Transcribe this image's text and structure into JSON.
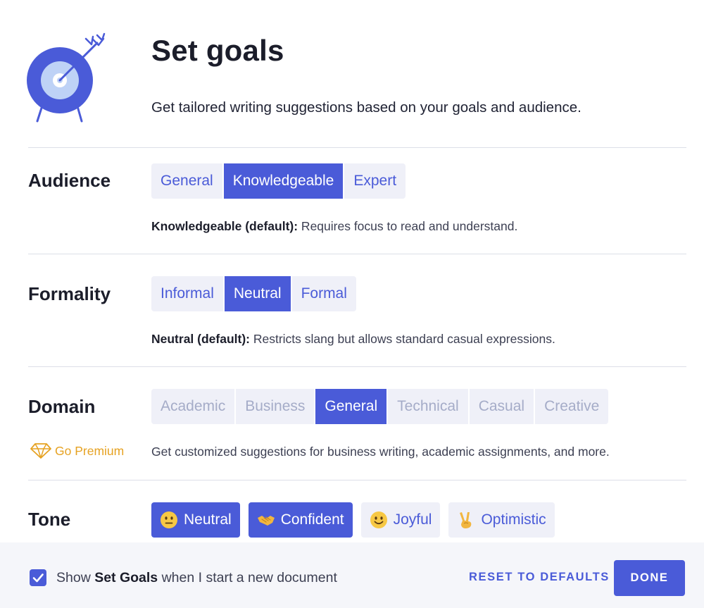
{
  "header": {
    "title": "Set goals",
    "subtitle": "Get tailored writing suggestions based on your goals and audience."
  },
  "audience": {
    "label": "Audience",
    "options": [
      "General",
      "Knowledgeable",
      "Expert"
    ],
    "selected": "Knowledgeable",
    "desc_bold": "Knowledgeable (default):",
    "desc_text": " Requires focus to read and understand."
  },
  "formality": {
    "label": "Formality",
    "options": [
      "Informal",
      "Neutral",
      "Formal"
    ],
    "selected": "Neutral",
    "desc_bold": "Neutral (default):",
    "desc_text": " Restricts slang but allows standard casual expressions."
  },
  "domain": {
    "label": "Domain",
    "options": [
      "Academic",
      "Business",
      "General",
      "Technical",
      "Casual",
      "Creative"
    ],
    "selected": "General",
    "premium_label": "Go Premium",
    "desc_text": "Get customized suggestions for business writing, academic assignments, and more."
  },
  "tone": {
    "label": "Tone",
    "options": [
      {
        "label": "Neutral",
        "icon": "neutral-face-icon",
        "active": true
      },
      {
        "label": "Confident",
        "icon": "handshake-icon",
        "active": true
      },
      {
        "label": "Joyful",
        "icon": "smiling-face-icon",
        "active": false
      },
      {
        "label": "Optimistic",
        "icon": "victory-hand-icon",
        "active": false
      }
    ]
  },
  "footer": {
    "checkbox_checked": true,
    "check_prefix": "Show ",
    "check_bold": "Set Goals",
    "check_suffix": " when I start a new document",
    "reset_label": "RESET TO DEFAULTS",
    "done_label": "DONE"
  },
  "colors": {
    "accent": "#4a5bd8",
    "button_bg": "#eff0f8",
    "disabled_text": "#a5acc8",
    "premium": "#e6a222",
    "footer_bg": "#f5f6fa"
  }
}
